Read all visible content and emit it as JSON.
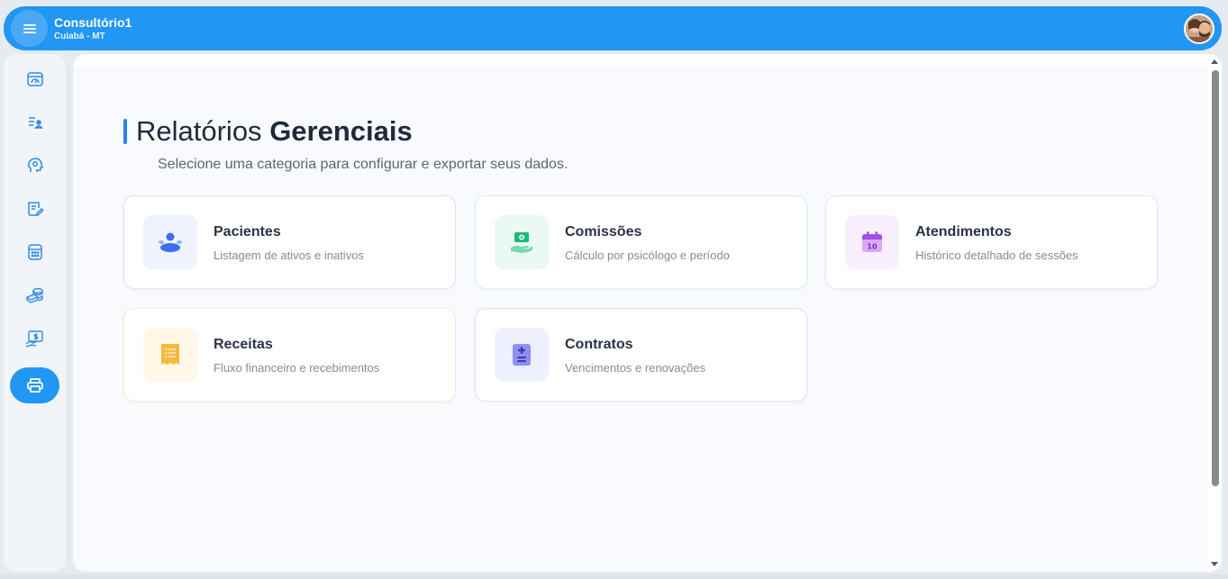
{
  "header": {
    "title": "Consultório1",
    "subtitle": "Cuiabá - MT",
    "menu_icon": "menu-icon",
    "avatar_icon": "user-avatar"
  },
  "sidebar": {
    "items": [
      {
        "name": "dashboard-icon",
        "active": false
      },
      {
        "name": "patients-list-icon",
        "active": false
      },
      {
        "name": "psychology-icon",
        "active": false
      },
      {
        "name": "contract-edit-icon",
        "active": false
      },
      {
        "name": "calculator-icon",
        "active": false
      },
      {
        "name": "money-icon",
        "active": false
      },
      {
        "name": "finance-report-icon",
        "active": false
      },
      {
        "name": "printer-icon",
        "active": true
      }
    ]
  },
  "page": {
    "title_regular": "Relatórios",
    "title_bold": "Gerenciais",
    "subtitle": "Selecione uma categoria para configurar e exportar seus dados."
  },
  "cards": [
    {
      "title": "Pacientes",
      "desc": "Listagem de ativos e inativos",
      "icon": "users-icon",
      "bg": "#eef3fd",
      "color": "#4a7cf0",
      "border": "#dde5f0"
    },
    {
      "title": "Comissões",
      "desc": "Cálculo por psicólogo e período",
      "icon": "commission-icon",
      "bg": "#eafaf3",
      "color": "#22c07d",
      "border": "#d6f1e6"
    },
    {
      "title": "Atendimentos",
      "desc": "Histórico detalhado de sessões",
      "icon": "calendar-icon",
      "bg": "#f8f0fd",
      "color": "#a855f7",
      "border": "#e9e4f1"
    },
    {
      "title": "Receitas",
      "desc": "Fluxo financeiro e recebimentos",
      "icon": "receipt-icon",
      "bg": "#fff8e6",
      "color": "#f5b331",
      "border": "#f4ecd2"
    },
    {
      "title": "Contratos",
      "desc": "Vencimentos e renovações",
      "icon": "contract-icon",
      "bg": "#eff0fd",
      "color": "#7b7fe8",
      "border": "#dde5f0"
    }
  ]
}
